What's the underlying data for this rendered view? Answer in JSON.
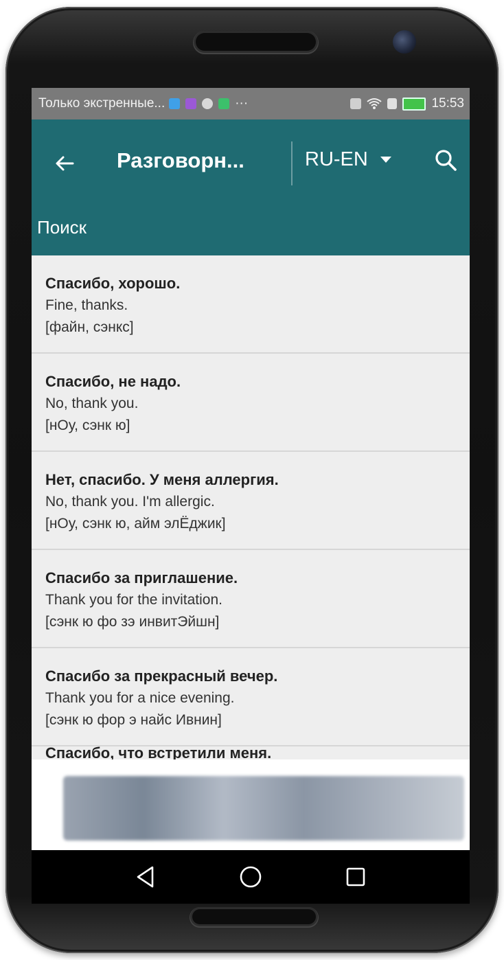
{
  "status": {
    "notification_text": "Только экстренные...",
    "time": "15:53"
  },
  "toolbar": {
    "title": "Разговорн...",
    "language": "RU-EN",
    "search_label": "Поиск"
  },
  "phrases": [
    {
      "ru": "Спасибо, хорошо.",
      "en": "Fine, thanks.",
      "tr": "[файн, сэнкс]"
    },
    {
      "ru": "Спасибо, не надо.",
      "en": "No, thank you.",
      "tr": "[нОу, сэнк ю]"
    },
    {
      "ru": "Нет, спасибо. У меня аллергия.",
      "en": "No, thank you. I'm allergic.",
      "tr": "[нОу, сэнк ю, айм элЁджик]"
    },
    {
      "ru": "Спасибо за приглашение.",
      "en": "Thank you for the invitation.",
      "tr": "[сэнк ю фо зэ инвитЭйшн]"
    },
    {
      "ru": "Спасибо за прекрасный вечер.",
      "en": "Thank you for a nice evening.",
      "tr": "[сэнк ю фор э найс Ивнин]"
    }
  ],
  "partial_item": "Спасибо, что встретили меня.",
  "icons": {
    "back": "arrow-left-icon",
    "search": "search-icon",
    "dropdown": "caret-down-icon",
    "nav_back": "triangle-back-icon",
    "nav_home": "circle-home-icon",
    "nav_recents": "square-recents-icon"
  },
  "colors": {
    "toolbar": "#1f6b72",
    "statusbar": "#7a7a7a",
    "list_bg": "#eeeeee"
  }
}
